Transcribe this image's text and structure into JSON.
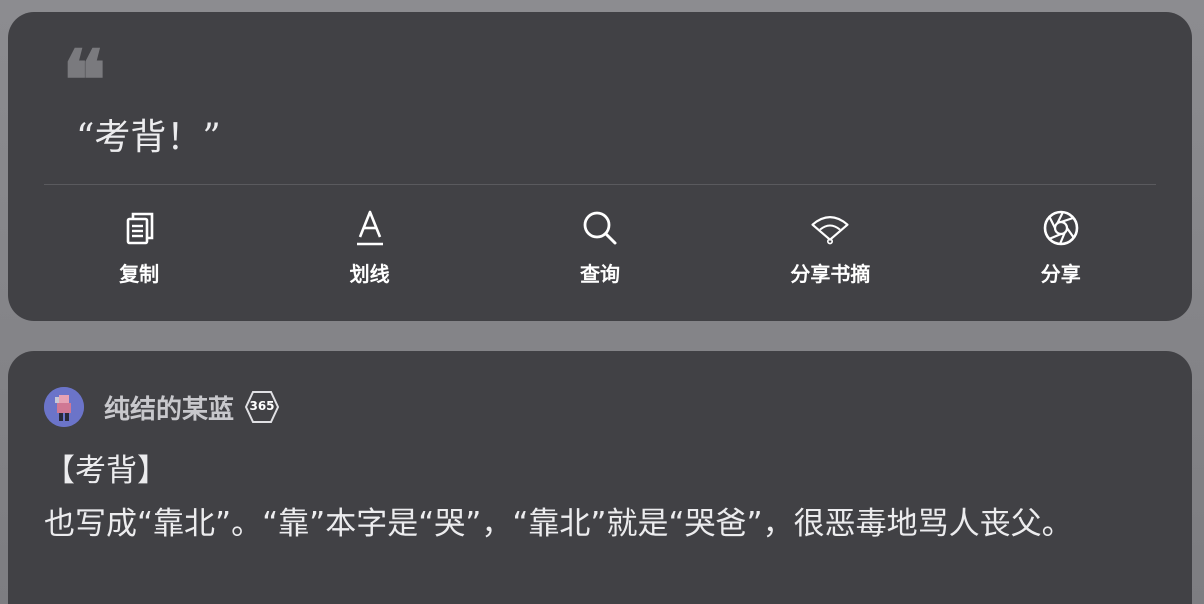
{
  "quote_card": {
    "quote_mark": "“",
    "quote_text": "“考背！”",
    "actions": [
      {
        "label": "复制",
        "icon": "copy-icon"
      },
      {
        "label": "划线",
        "icon": "underline-icon"
      },
      {
        "label": "查询",
        "icon": "search-icon"
      },
      {
        "label": "分享书摘",
        "icon": "fan-share-icon"
      },
      {
        "label": "分享",
        "icon": "aperture-share-icon"
      }
    ]
  },
  "note": {
    "username": "纯结的某蓝",
    "badge": "365",
    "title": "【考背】",
    "body": "也写成“靠北”。“靠”本字是“哭”，“靠北”就是“哭爸”，很恶毒地骂人丧父。"
  },
  "colors": {
    "card_bg": "#414145",
    "page_bg": "#87878b",
    "text": "#ececee",
    "avatar_bg": "#6b74c9"
  }
}
